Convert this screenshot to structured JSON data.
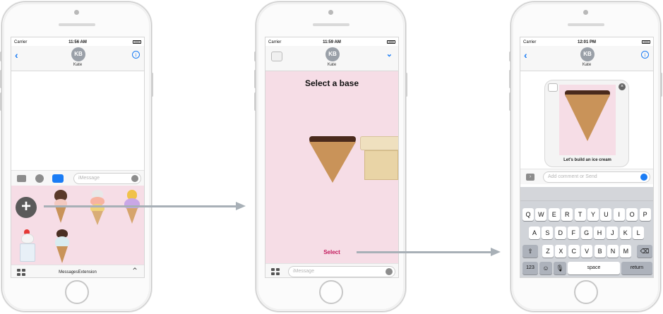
{
  "phone1": {
    "status": {
      "carrier": "Carrier",
      "time": "11:56 AM"
    },
    "contact": {
      "initials": "KB",
      "name": "Kate"
    },
    "compose": {
      "placeholder": "iMessage"
    },
    "drawer": {
      "title": "MessagesExtension"
    }
  },
  "phone2": {
    "status": {
      "carrier": "Carrier",
      "time": "11:59 AM"
    },
    "contact": {
      "initials": "KB",
      "name": "Kate"
    },
    "heading": "Select a base",
    "select_label": "Select",
    "compose": {
      "placeholder": "iMessage"
    }
  },
  "phone3": {
    "status": {
      "carrier": "Carrier",
      "time": "12:01 PM"
    },
    "contact": {
      "initials": "KB",
      "name": "Kate"
    },
    "bubble_caption": "Let's build an ice cream",
    "compose": {
      "placeholder": "Add comment or Send"
    },
    "keyboard": {
      "row1": [
        "Q",
        "W",
        "E",
        "R",
        "T",
        "Y",
        "U",
        "I",
        "O",
        "P"
      ],
      "row2": [
        "A",
        "S",
        "D",
        "F",
        "G",
        "H",
        "J",
        "K",
        "L"
      ],
      "row3": [
        "Z",
        "X",
        "C",
        "V",
        "B",
        "N",
        "M"
      ],
      "numbers": "123",
      "space": "space",
      "return": "return"
    }
  },
  "colors": {
    "accent": "#1a7cf5",
    "pink": "#f6dde6",
    "select": "#c2185b",
    "arrow": "#a8b0b7"
  }
}
